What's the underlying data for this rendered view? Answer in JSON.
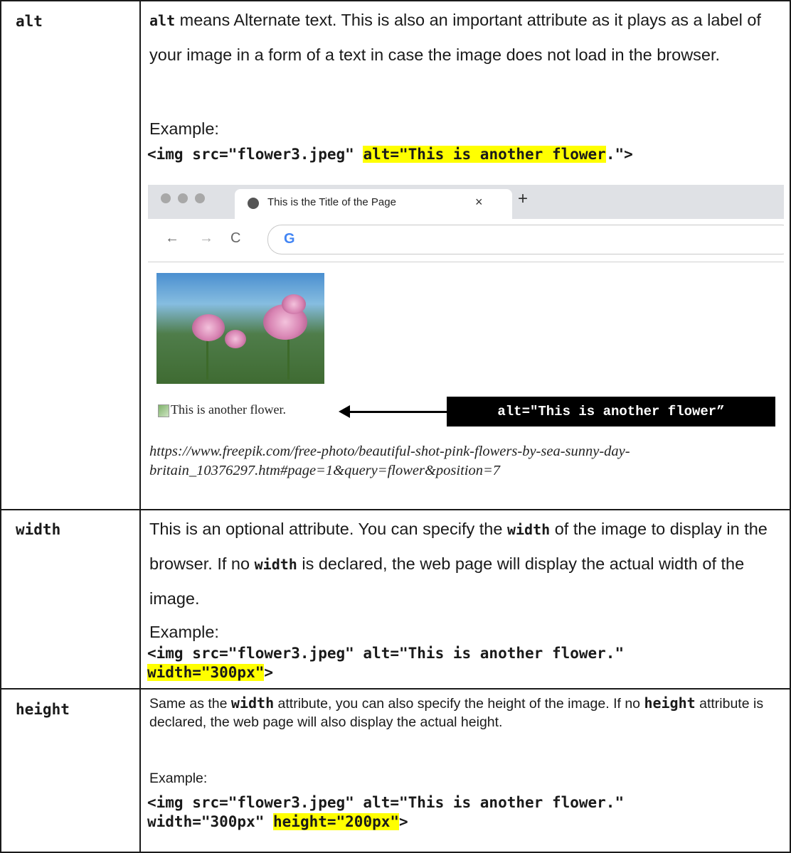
{
  "rows": {
    "alt": {
      "attr": "alt",
      "desc_code": "alt",
      "desc_rest": " means Alternate text. This is also an important attribute as it plays as a label of your image in a form of a text in case the image does not load in the browser.",
      "example_label": "Example:",
      "code_pre": "<img src=\"flower3.jpeg\" ",
      "code_hl": "alt=\"This is another flower",
      "code_post": ".\">",
      "screenshot": {
        "tab_title": "This is the Title of the Page",
        "tab_close": "×",
        "new_tab": "+",
        "back": "←",
        "forward": "→",
        "reload": "C",
        "google_logo": "G",
        "broken_image_text": "This is another flower.",
        "callout": "alt=\"This is another flower”"
      },
      "source_url": "https://www.freepik.com/free-photo/beautiful-shot-pink-flowers-by-sea-sunny-day-britain_10376297.htm#page=1&query=flower&position=7"
    },
    "width": {
      "attr": "width",
      "desc_a": "This is an optional attribute. You can specify the ",
      "desc_code1": "width",
      "desc_b": " of the image to display in the browser. If no ",
      "desc_code2": "width",
      "desc_c": " is declared, the web page will display the actual width of the image.",
      "example_label": "Example:",
      "code_line1": "<img src=\"flower3.jpeg\" alt=\"This is another flower.\"",
      "code_hl": "width=\"300px\"",
      "code_post": ">"
    },
    "height": {
      "attr": "height",
      "desc_a": "Same as the ",
      "desc_code1": "width",
      "desc_b": " attribute, you can also specify the height of the image. If no ",
      "desc_code2": "height",
      "desc_c": " attribute is declared, the web page will also display the actual height.",
      "example_label": "Example:",
      "code_line1": "<img src=\"flower3.jpeg\" alt=\"This is another flower.\"",
      "code_pre2": "width=\"300px\" ",
      "code_hl": "height=\"200px\"",
      "code_post": ">"
    }
  }
}
